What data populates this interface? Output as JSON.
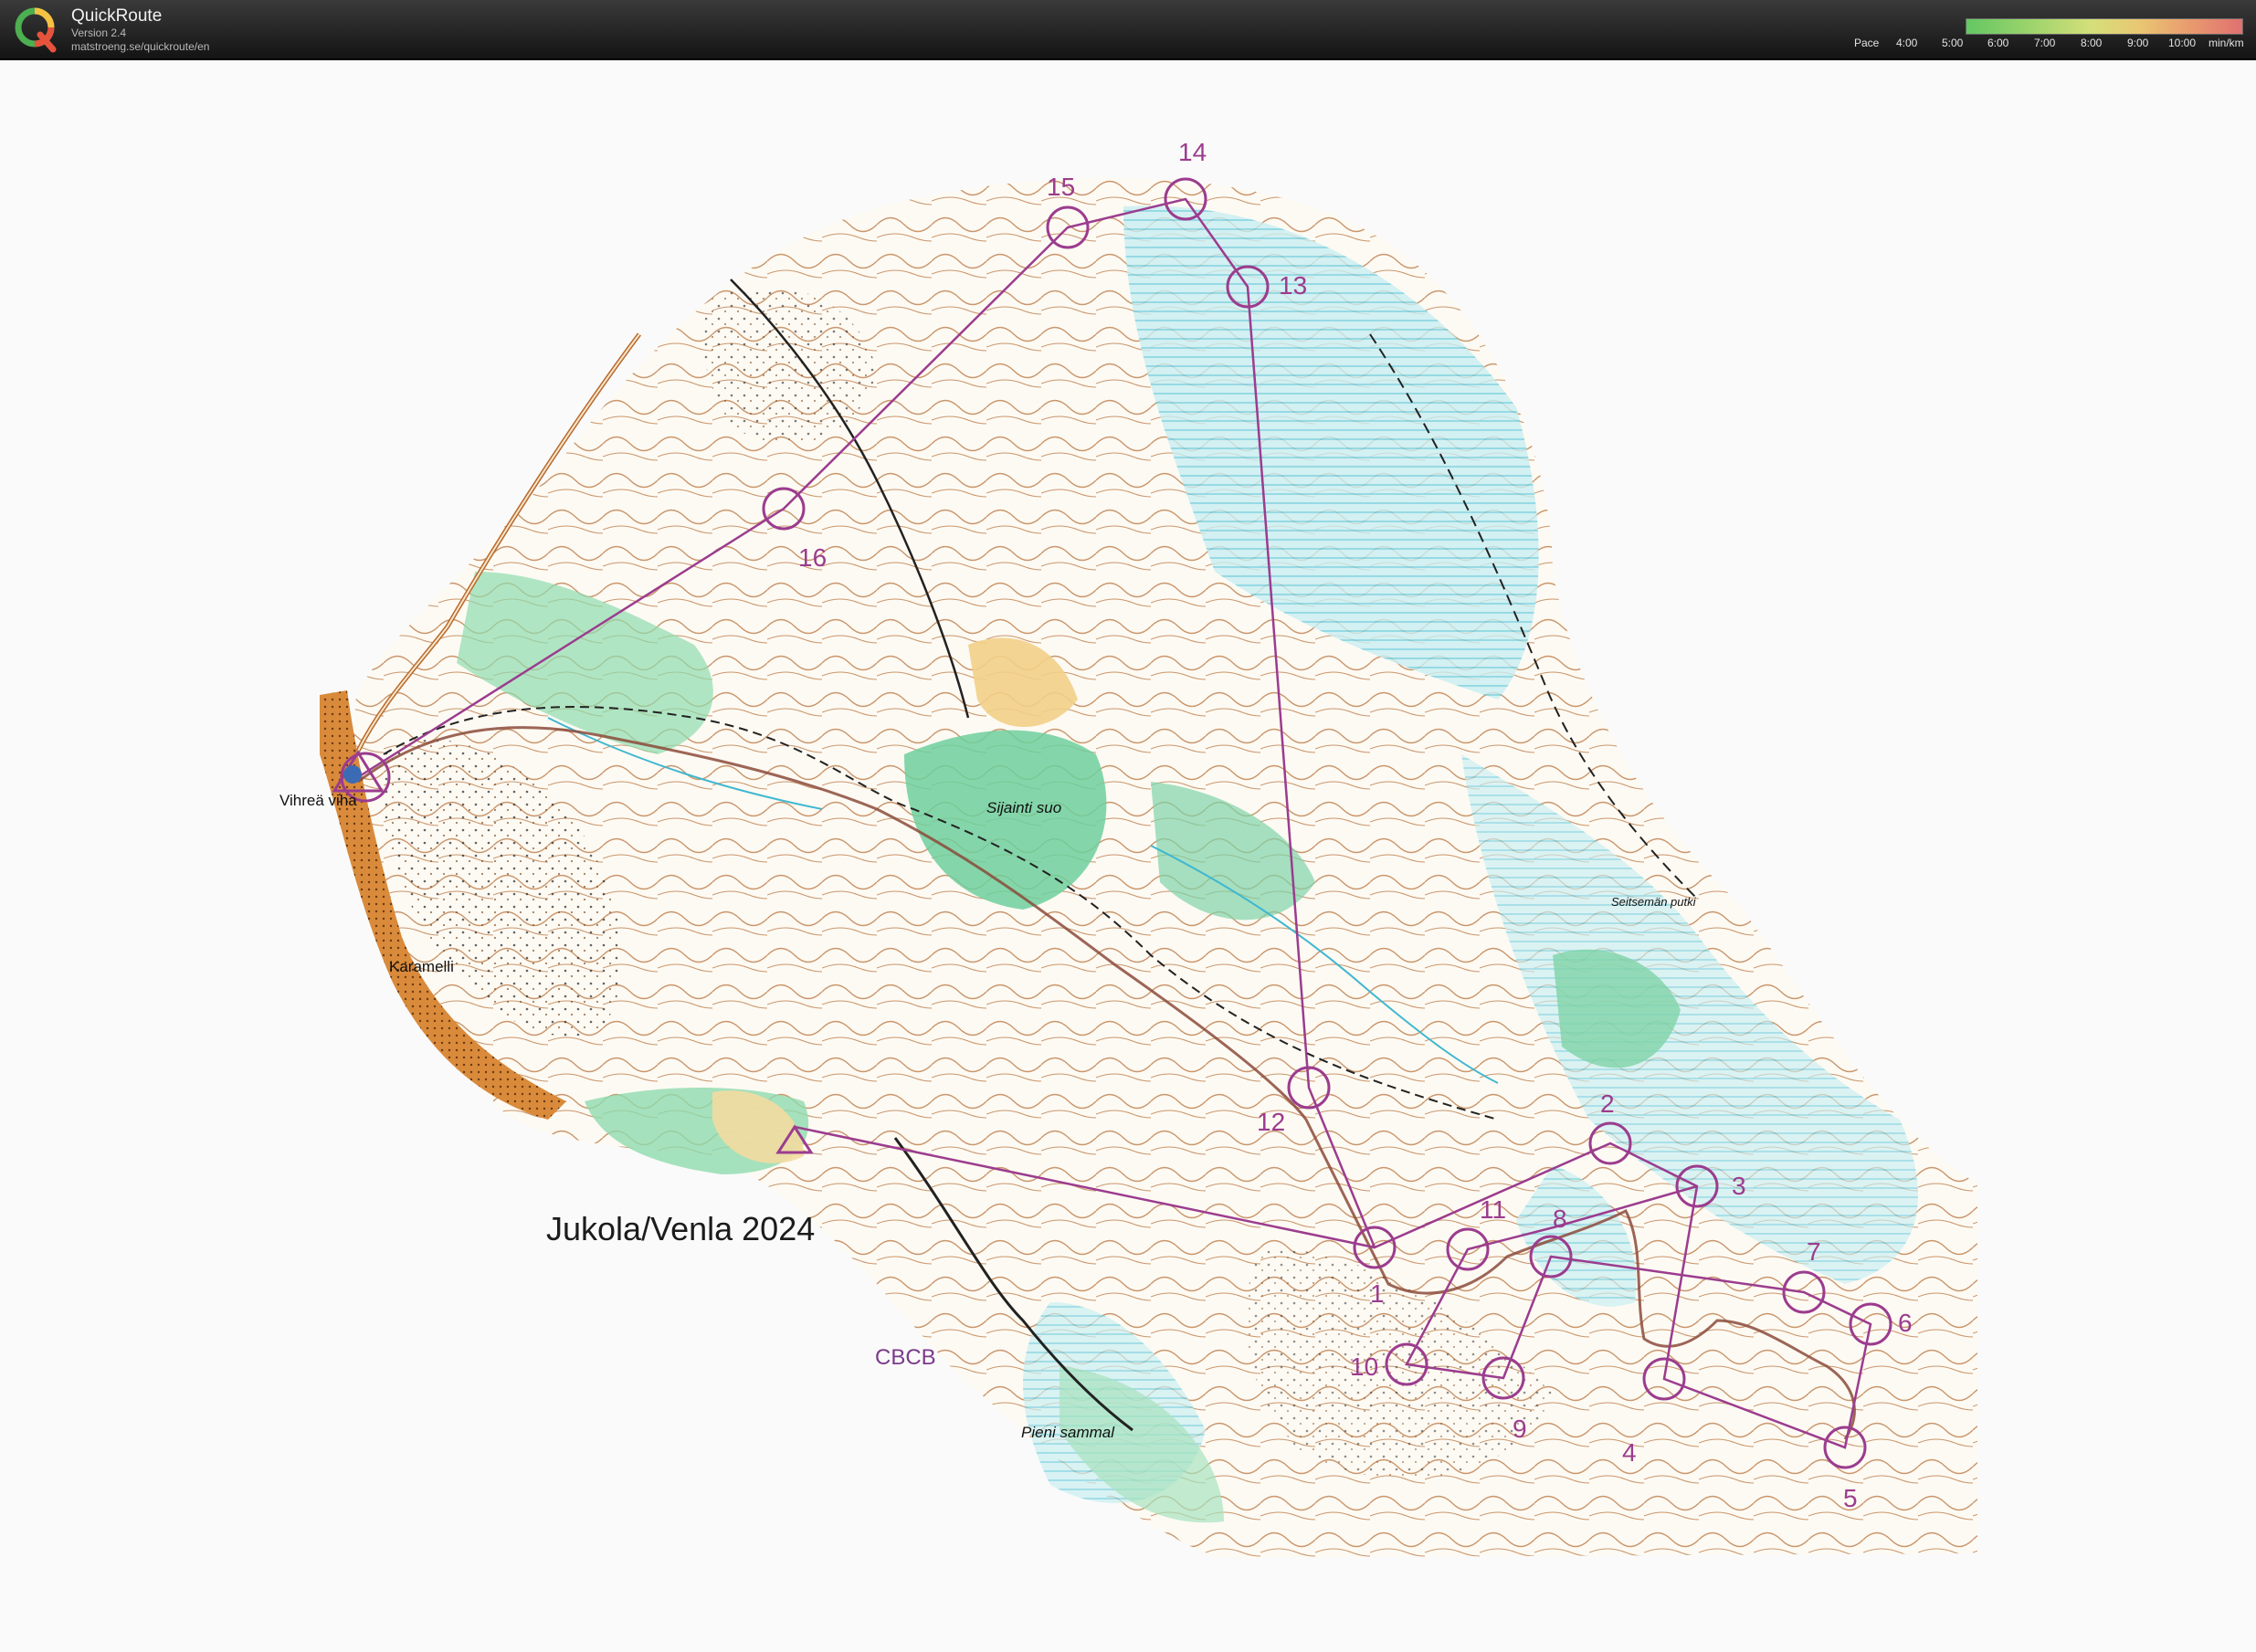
{
  "app": {
    "title": "QuickRoute",
    "version": "Version 2.4",
    "url": "matstroeng.se/quickroute/en"
  },
  "pace_legend": {
    "label": "Pace",
    "ticks": [
      "4:00",
      "5:00",
      "6:00",
      "7:00",
      "8:00",
      "9:00",
      "10:00"
    ],
    "unit": "min/km",
    "colors": [
      "#63c763",
      "#9ad36b",
      "#d4df7a",
      "#e9c873",
      "#e99d6f",
      "#e07070"
    ]
  },
  "map": {
    "title": "Jukola/Venla 2024",
    "code": "CBCB",
    "places": {
      "vihrea_viha": "Vihreä viha",
      "karamelli": "Karamelli",
      "sijainti_suo": "Sijainti suo",
      "seitseman_putki": "Seitsemän putki",
      "pieni_sammal": "Pieni sammal"
    },
    "controls": [
      "1",
      "2",
      "3",
      "4",
      "5",
      "6",
      "7",
      "8",
      "9",
      "10",
      "11",
      "12",
      "13",
      "14",
      "15",
      "16"
    ],
    "colors": {
      "course": "#9b3c8e",
      "route": "#8b4a3a",
      "open_land": "#f2cf87",
      "road": "#b9692e",
      "green": "#7ccf9c",
      "marsh": "#6fd0e0",
      "contour": "#b8743f"
    }
  }
}
